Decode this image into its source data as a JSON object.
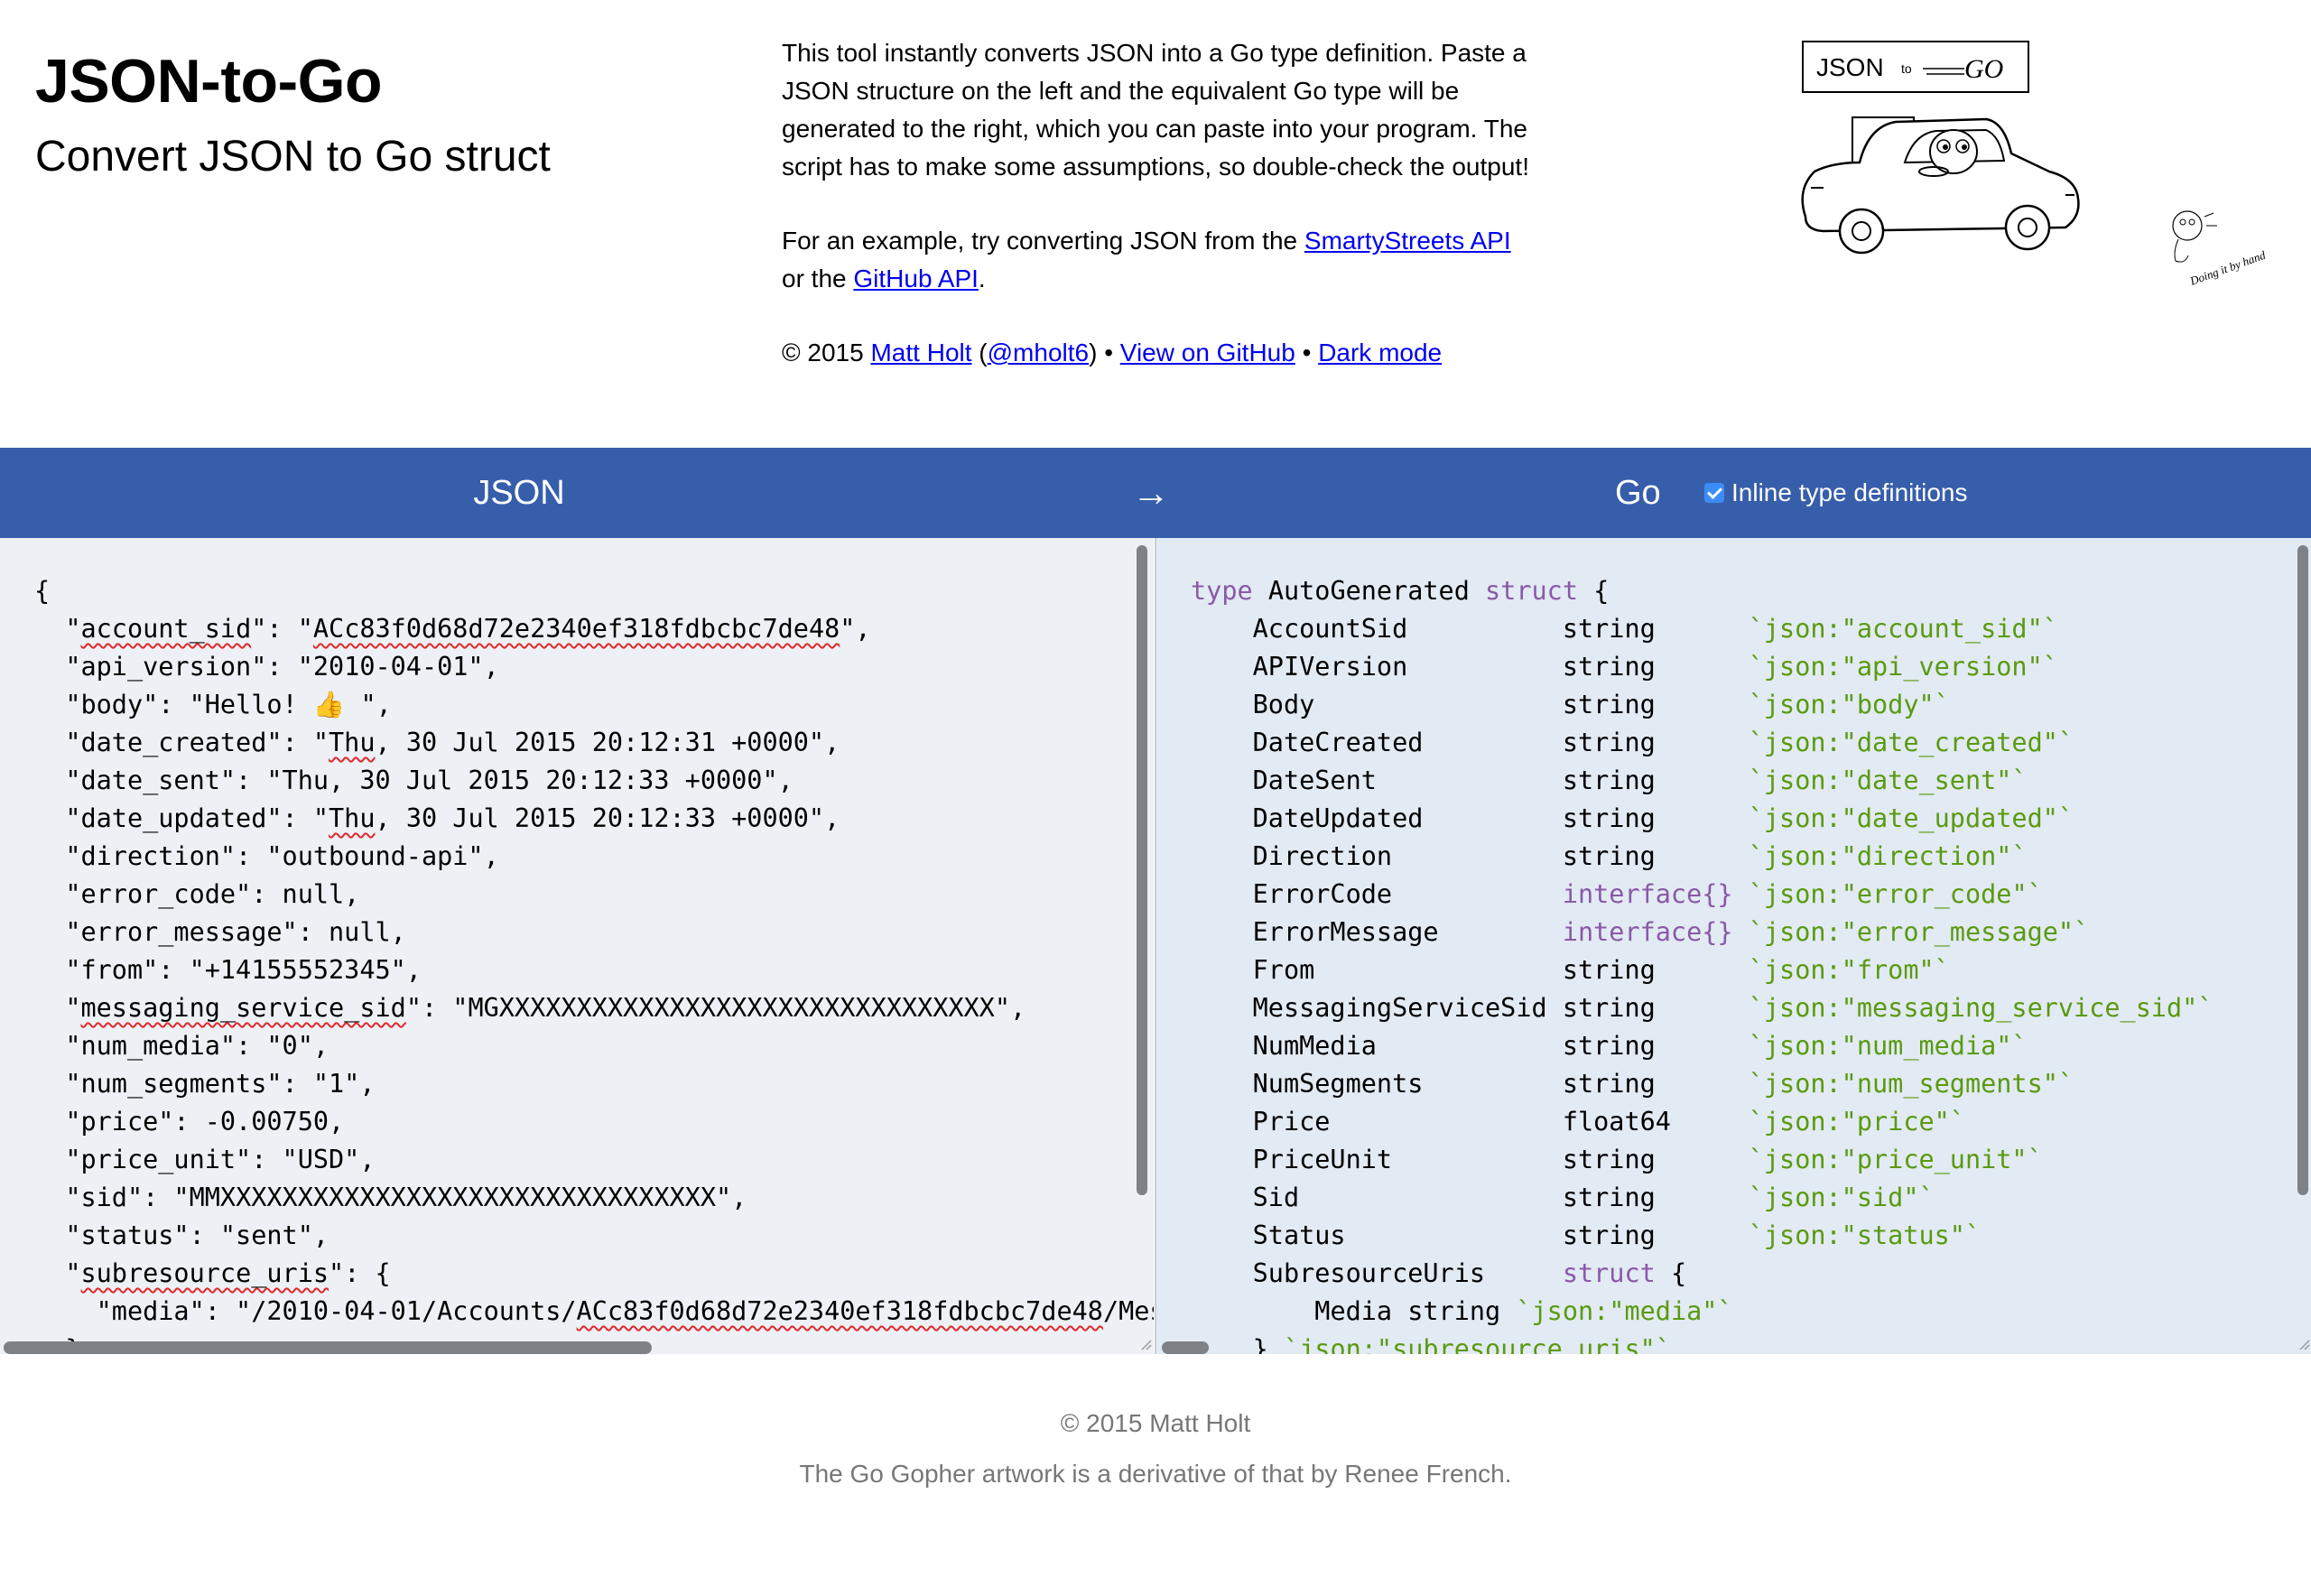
{
  "header": {
    "title": "JSON-to-Go",
    "subtitle": "Convert JSON to Go struct",
    "description": "This tool instantly converts JSON into a Go type definition. Paste a JSON structure on the left and the equivalent Go type will be generated to the right, which you can paste into your program. The script has to make some assumptions, so double-check the output!",
    "example_prefix": "For an example, try converting JSON from the ",
    "smartystreets_link": "SmartyStreets API",
    "example_mid": " or the ",
    "github_api_link": "GitHub API",
    "example_suffix": ".",
    "copyright_prefix": "© 2015 ",
    "author_link": "Matt Holt",
    "paren_open": " (",
    "twitter_link": "@mholt6",
    "paren_close": ") • ",
    "view_github_link": "View on GitHub",
    "bullet": " • ",
    "dark_mode_link": "Dark mode"
  },
  "artwork": {
    "sign_json": "JSON",
    "sign_to": "to",
    "sign_go": "GO",
    "doing_by_hand": "Doing it by hand"
  },
  "bar": {
    "json_label": "JSON",
    "arrow": "→",
    "go_label": "Go",
    "inline_label": "Inline type definitions",
    "inline_checked": true,
    "bar_color": "#375eab"
  },
  "json_input": {
    "l01": "{",
    "l02_k": "account_sid",
    "l02_v": "ACc83f0d68d72e2340ef318fdbcbc7de48",
    "l03": "  \"api_version\": \"2010-04-01\",",
    "l04": "  \"body\": \"Hello! 👍 \",",
    "l05_pre": "  \"date_created\": \"",
    "l05_w": "Thu",
    "l05_post": ", 30 Jul 2015 20:12:31 +0000\",",
    "l06": "  \"date_sent\": \"Thu, 30 Jul 2015 20:12:33 +0000\",",
    "l07_pre": "  \"date_updated\": \"",
    "l07_w": "Thu",
    "l07_post": ", 30 Jul 2015 20:12:33 +0000\",",
    "l08": "  \"direction\": \"outbound-api\",",
    "l09": "  \"error_code\": null,",
    "l10": "  \"error_message\": null,",
    "l11": "  \"from\": \"+14155552345\",",
    "l12_k": "messaging_service_sid",
    "l12_v": "MGXXXXXXXXXXXXXXXXXXXXXXXXXXXXXXXX",
    "l13": "  \"num_media\": \"0\",",
    "l14": "  \"num_segments\": \"1\",",
    "l15": "  \"price\": -0.00750,",
    "l16": "  \"price_unit\": \"USD\",",
    "l17_pre": "  \"sid\": \"",
    "l17_w": "MMXXXXXXXXXXXXXXXXXXXXXXXXXXXXXXXX",
    "l17_post": "\",",
    "l18": "  \"status\": \"sent\",",
    "l19_k": "subresource_uris",
    "l19_post": "\": {",
    "l20_pre": "    \"media\": \"/2010-04-01/Accounts/",
    "l20_w": "ACc83f0d68d72e2340ef318fdbcbc7de48",
    "l20_post": "/Mess",
    "l21": "  },"
  },
  "go_output": {
    "type_kw": "type",
    "struct_name": "AutoGenerated",
    "struct_kw": "struct",
    "open": "{",
    "fields": [
      {
        "name": "AccountSid",
        "type": "string",
        "tag": "`json:\"account_sid\"`"
      },
      {
        "name": "APIVersion",
        "type": "string",
        "tag": "`json:\"api_version\"`"
      },
      {
        "name": "Body",
        "type": "string",
        "tag": "`json:\"body\"`"
      },
      {
        "name": "DateCreated",
        "type": "string",
        "tag": "`json:\"date_created\"`"
      },
      {
        "name": "DateSent",
        "type": "string",
        "tag": "`json:\"date_sent\"`"
      },
      {
        "name": "DateUpdated",
        "type": "string",
        "tag": "`json:\"date_updated\"`"
      },
      {
        "name": "Direction",
        "type": "string",
        "tag": "`json:\"direction\"`"
      },
      {
        "name": "ErrorCode",
        "type": "interface{}",
        "tag": "`json:\"error_code\"`"
      },
      {
        "name": "ErrorMessage",
        "type": "interface{}",
        "tag": "`json:\"error_message\"`"
      },
      {
        "name": "From",
        "type": "string",
        "tag": "`json:\"from\"`"
      },
      {
        "name": "MessagingServiceSid",
        "type": "string",
        "tag": "`json:\"messaging_service_sid\"`"
      },
      {
        "name": "NumMedia",
        "type": "string",
        "tag": "`json:\"num_media\"`"
      },
      {
        "name": "NumSegments",
        "type": "string",
        "tag": "`json:\"num_segments\"`"
      },
      {
        "name": "Price",
        "type": "float64",
        "tag": "`json:\"price\"`"
      },
      {
        "name": "PriceUnit",
        "type": "string",
        "tag": "`json:\"price_unit\"`"
      },
      {
        "name": "Sid",
        "type": "string",
        "tag": "`json:\"sid\"`"
      },
      {
        "name": "Status",
        "type": "string",
        "tag": "`json:\"status\"`"
      }
    ],
    "sub_name": "SubresourceUris",
    "sub_type": "struct",
    "sub_open": "{",
    "media_decl": "Media string",
    "media_tag": "`json:\"media\"`",
    "sub_close": "}",
    "sub_tag": "`json:\"subresource_uris\"`"
  },
  "footer": {
    "copyright": "© 2015 Matt Holt",
    "credit": "The Go Gopher artwork is a derivative of that by Renee French."
  },
  "colors": {
    "keyword": "#8959a8",
    "tag": "#5a9a0f",
    "left_pane_bg": "#edf1f5",
    "right_pane_bg": "#e2eaf3"
  }
}
